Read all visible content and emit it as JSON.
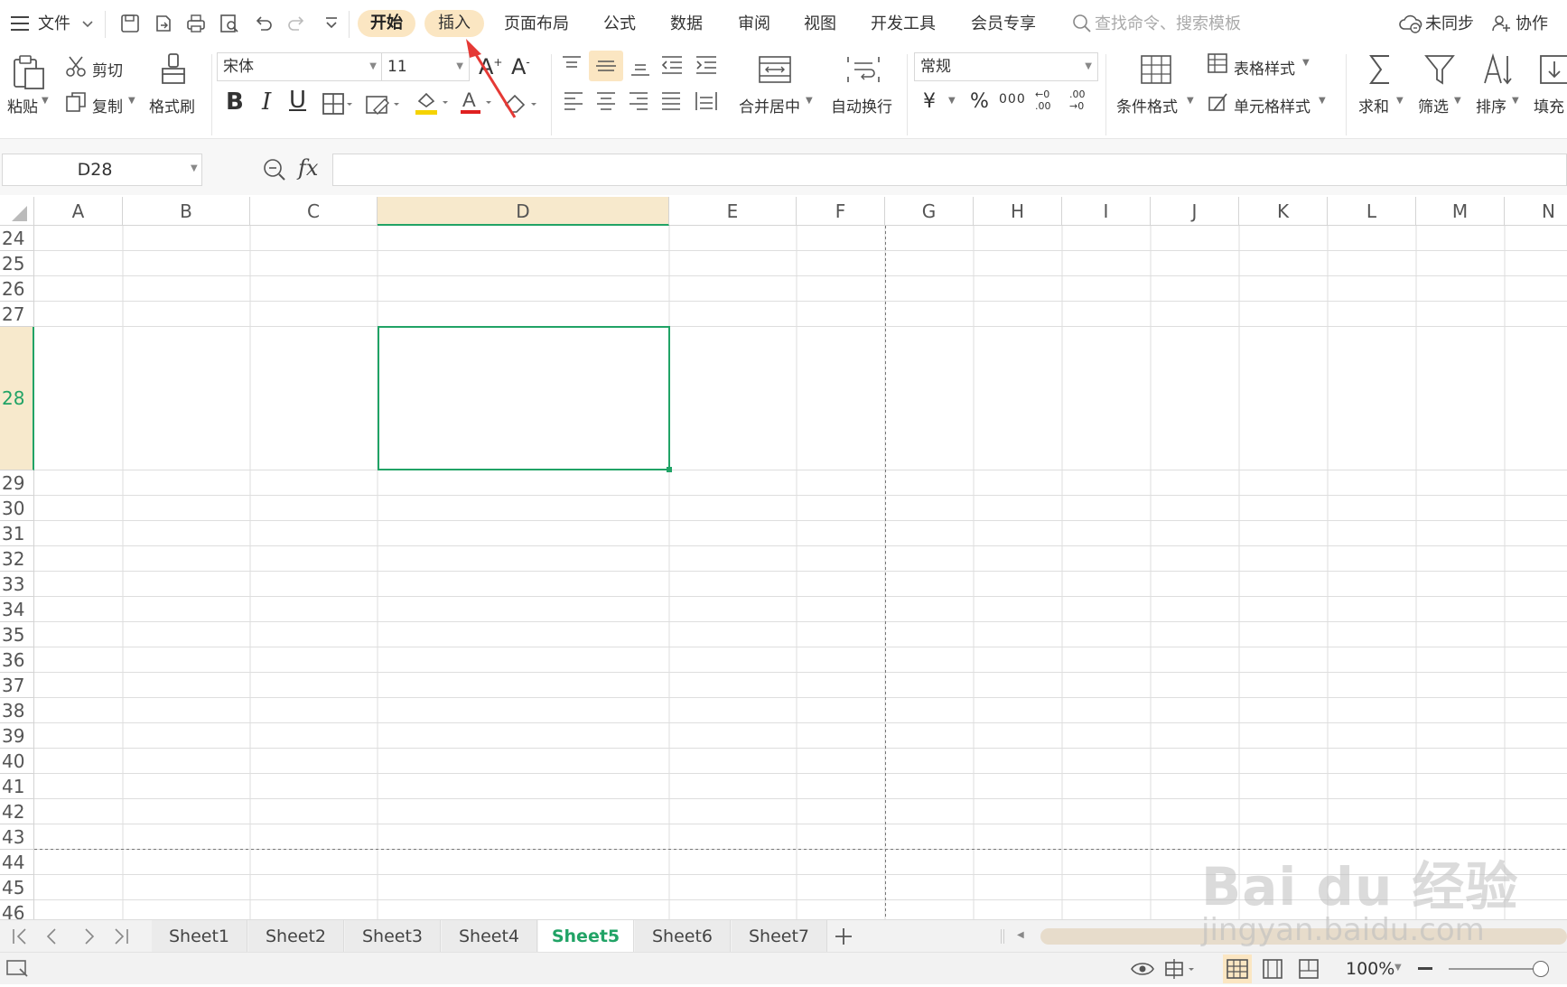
{
  "menubar": {
    "file_label": "文件",
    "tabs": [
      "开始",
      "插入",
      "页面布局",
      "公式",
      "数据",
      "审阅",
      "视图",
      "开发工具",
      "会员专享"
    ],
    "search_placeholder": "查找命令、搜索模板",
    "sync_label": "未同步",
    "collab_label": "协作"
  },
  "ribbon": {
    "paste": "粘贴",
    "cut": "剪切",
    "copy": "复制",
    "format_painter": "格式刷",
    "font_name": "宋体",
    "font_size": "11",
    "merge_center": "合并居中",
    "wrap_text": "自动换行",
    "number_format": "常规",
    "conditional_format": "条件格式",
    "table_style": "表格样式",
    "cell_style": "单元格样式",
    "sum": "求和",
    "filter": "筛选",
    "sort": "排序",
    "fill": "填充",
    "currency": "¥",
    "percent": "%",
    "thousands": "000",
    "inc_decimal": "←0 .00",
    "dec_decimal": ".00 →0"
  },
  "formula_bar": {
    "cell_ref": "D28",
    "fx_label": "fx",
    "formula_value": ""
  },
  "grid": {
    "columns": [
      "A",
      "B",
      "C",
      "D",
      "E",
      "F",
      "G",
      "H",
      "I",
      "J",
      "K",
      "L",
      "M",
      "N"
    ],
    "rows": [
      "24",
      "25",
      "26",
      "27",
      "28",
      "29",
      "30",
      "31",
      "32",
      "33",
      "34",
      "35",
      "36",
      "37",
      "38",
      "39",
      "40",
      "41",
      "42",
      "43",
      "44",
      "45",
      "46"
    ],
    "active_column": "D",
    "active_row": "28"
  },
  "sheets": {
    "tabs": [
      "Sheet1",
      "Sheet2",
      "Sheet3",
      "Sheet4",
      "Sheet5",
      "Sheet6",
      "Sheet7"
    ],
    "active": "Sheet5"
  },
  "statusbar": {
    "zoom": "100%"
  },
  "watermark": {
    "brand": "Bai du 经验",
    "url": "jingyan.baidu.com"
  },
  "colors": {
    "accent_green": "#21a366",
    "pill_bg": "#fbe6c2",
    "header_highlight": "#f7e9cc",
    "annotation_red": "#e53935"
  }
}
